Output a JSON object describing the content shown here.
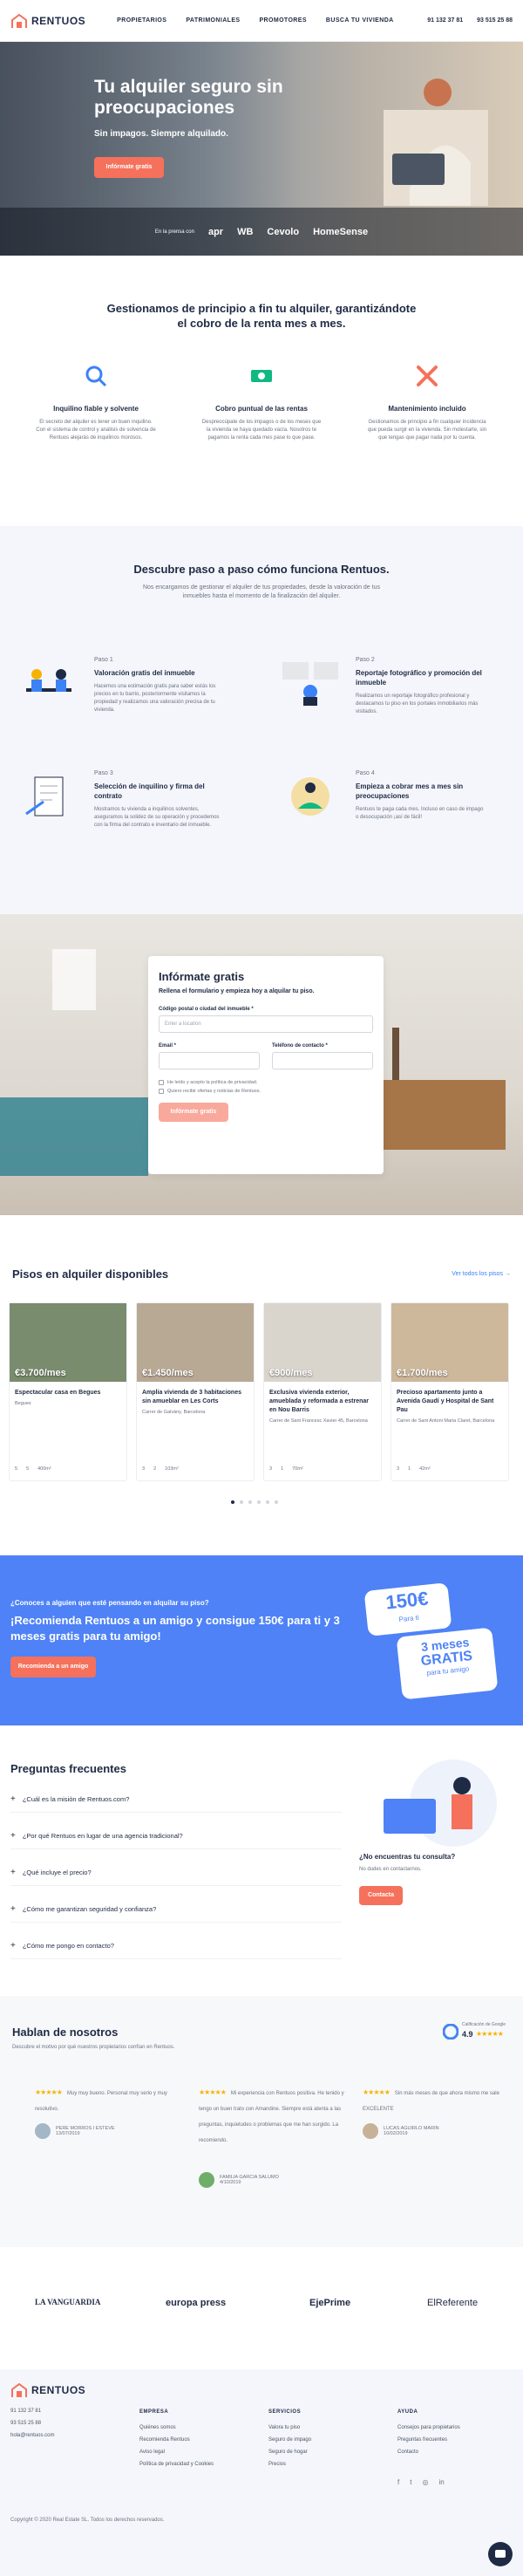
{
  "header": {
    "brand": "RENTUOS",
    "nav": [
      "PROPIETARIOS",
      "PATRIMONIALES",
      "PROMOTORES",
      "BUSCA TU VIVIENDA"
    ],
    "phones": [
      "91 132 37 81",
      "93 515 25 88"
    ]
  },
  "hero": {
    "title": "Tu alquiler seguro sin preocupaciones",
    "subtitle": "Sin impagos. Siempre alquilado.",
    "cta": "Infórmate gratis",
    "strip_label": "En la prensa con",
    "strip_logos": [
      "apr",
      "WB",
      "Cevolo",
      "HomeSense"
    ]
  },
  "intro": {
    "title": "Gestionamos de principio a fin tu alquiler, garantizándote el cobro de la renta mes a mes.",
    "features": [
      {
        "title": "Inquilino fiable y solvente",
        "text": "El secreto del alquiler es tener un buen inquilino. Con el sistema de control y análisis de solvencia de Rentuos alejarás de inquilinos morosos.",
        "icon": "search-icon",
        "color": "#3b82f6"
      },
      {
        "title": "Cobro puntual de las rentas",
        "text": "Despreocúpate de los impagos o de los meses que la vivienda se haya quedado vacía. Nosotros te pagamos la renta cada mes pase lo que pase.",
        "icon": "money-icon",
        "color": "#10b981"
      },
      {
        "title": "Mantenimiento incluido",
        "text": "Gestionamos de principio a fin cualquier incidencia que pueda surgir en la vivienda. Sin molestarte, sin que tengas que pagar nada por tu cuenta.",
        "icon": "tools-icon",
        "color": "#f5715b"
      }
    ]
  },
  "how": {
    "title": "Descubre paso a paso cómo funciona Rentuos.",
    "intro": "Nos encargamos de gestionar el alquiler de tus propiedades, desde la valoración de tus inmuebles hasta el momento de la finalización del alquiler.",
    "steps": [
      {
        "num": "Paso 1",
        "title": "Valoración gratis del inmueble",
        "text": "Hacemos una estimación gratis para saber estás los precios en tu barrio, posteriormente visitamos la propiedad y realizamos una valoración precisa de tu vivienda."
      },
      {
        "num": "Paso 2",
        "title": "Reportaje fotográfico y promoción del inmueble",
        "text": "Realizamos un reportaje fotográfico profesional y destacamos tu piso en los portales inmobiliarios más visitados."
      },
      {
        "num": "Paso 3",
        "title": "Selección de inquilino y firma del contrato",
        "text": "Mostramos tu vivienda a inquilinos solventes, aseguramos la solidez de su operación y procedemos con la firma del contrato e inventario del inmueble."
      },
      {
        "num": "Paso 4",
        "title": "Empieza a cobrar mes a mes sin preocupaciones",
        "text": "Rentuos te paga cada mes. Incluso en caso de impago o desocupación ¡así de fácil!"
      }
    ]
  },
  "form": {
    "title": "Infórmate gratis",
    "subtitle": "Rellena el formulario y empieza hoy a alquilar tu piso.",
    "city_label": "Código postal o ciudad del inmueble *",
    "city_placeholder": "Enter a location",
    "email_label": "Email *",
    "phone_label": "Teléfono de contacto *",
    "consent": "He leído y acepto la política de privacidad.",
    "news": "Quiero recibir ofertas y noticias de Rentuos.",
    "submit": "Infórmate gratis"
  },
  "listings": {
    "title": "Pisos en alquiler disponibles",
    "see_all": "Ver todos los pisos →",
    "cards": [
      {
        "price": "€3.700/mes",
        "title": "Espectacular casa en Begues",
        "address": "Begues",
        "rooms": "5",
        "baths": "5",
        "area": "400m²"
      },
      {
        "price": "€1.450/mes",
        "title": "Amplia vivienda de 3 habitaciones sin amueblar en Les Corts",
        "address": "Carrer de Galvàny, Barcelona",
        "rooms": "3",
        "baths": "2",
        "area": "103m²"
      },
      {
        "price": "€900/mes",
        "title": "Exclusiva vivienda exterior, amueblada y reformada a estrenar en Nou Barris",
        "address": "Carrer de Sant Francesc Xavier 45, Barcelona",
        "rooms": "3",
        "baths": "1",
        "area": "70m²"
      },
      {
        "price": "€1.700/mes",
        "title": "Precioso apartamento junto a Avenida Gaudí y Hospital de Sant Pau",
        "address": "Carrer de Sant Antoni Maria Claret, Barcelona",
        "rooms": "3",
        "baths": "1",
        "area": "42m²"
      }
    ]
  },
  "refer": {
    "question": "¿Conoces a alguien que esté pensando en alquilar su piso?",
    "title": "¡Recomienda Rentuos a un amigo y consigue 150€ para ti y 3 meses gratis para tu amigo!",
    "cta": "Recomienda a un amigo",
    "badge_amount": "150€",
    "badge_for_you": "Para ti",
    "badge_months": "3 meses",
    "badge_free": "GRATIS",
    "badge_friend": "para tu amigo"
  },
  "faq": {
    "title": "Preguntas frecuentes",
    "items": [
      "¿Cuál es la misión de Rentuos.com?",
      "¿Por qué Rentuos en lugar de una agencia tradicional?",
      "¿Qué incluye el precio?",
      "¿Cómo me garantizan seguridad y confianza?",
      "¿Cómo me pongo en contacto?"
    ],
    "help_title": "¿No encuentras tu consulta?",
    "help_text": "No dudes en contactarnos.",
    "help_cta": "Contacta"
  },
  "reviews": {
    "title": "Hablan de nosotros",
    "subtitle": "Descubre el motivo por qué nuestros propietarios confían en Rentuos.",
    "google_label": "Calificación de Google",
    "google_score": "4.9",
    "items": [
      {
        "text": "Muy muy bueno. Personal muy serio y muy resolutivo.",
        "name": "PERE MORROS I ESTEVE",
        "date": "13/07/2019"
      },
      {
        "text": "Mi experiencia con Rentuos positiva. He tenido y tengo un buen trato con Amandine. Siempre está atenta a las preguntas, inquietudes o problemas que me han surgido. La recomiendo.",
        "name": "FAMILIA GARCIA SALUMO",
        "date": "4/10/2019"
      },
      {
        "text": "Sin más meses de que ahora mismo me sale EXCELENTE",
        "name": "LUCAS AGUIRLO MARIN",
        "date": "10/02/2019"
      }
    ]
  },
  "press": [
    "LA VANGUARDIA",
    "europa press",
    "EjePrime",
    "ElReferente"
  ],
  "footer": {
    "brand": "RENTUOS",
    "contacts": [
      "91 132 37 81",
      "93 515 25 88",
      "hola@rentuos.com"
    ],
    "columns": [
      {
        "title": "EMPRESA",
        "links": [
          "Quiénes somos",
          "Recomienda Rentuos",
          "Aviso legal",
          "Política de privacidad y Cookies"
        ]
      },
      {
        "title": "SERVICIOS",
        "links": [
          "Valora tu piso",
          "Seguro de impago",
          "Seguro de hogar",
          "Precios"
        ]
      },
      {
        "title": "AYUDA",
        "links": [
          "Consejos para propietarios",
          "Preguntas frecuentes",
          "Contacto"
        ]
      }
    ],
    "copyright": "Copyright © 2020 Real Estate SL. Todos los derechos reservados."
  },
  "colors": {
    "accent": "#f5715b",
    "blue": "#4e82f6",
    "navy": "#1f2a44"
  }
}
